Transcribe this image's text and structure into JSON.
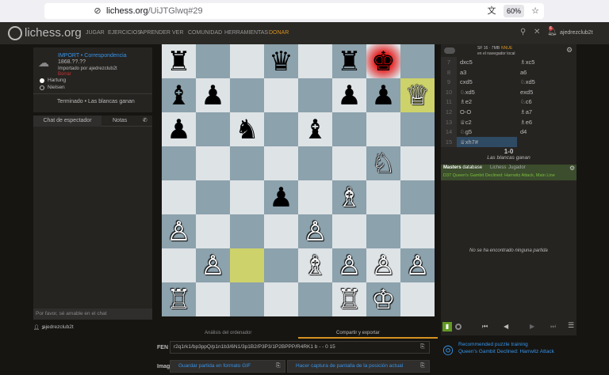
{
  "browser": {
    "url_host": "lichess.org",
    "url_path": "/UiJTGlwq#29",
    "zoom": "60%"
  },
  "nav": {
    "site_name": "lichess.org",
    "items": [
      "JUGAR",
      "EJERCICIOS",
      "APRENDER",
      "VER",
      "COMUNIDAD",
      "HERRAMIENTAS",
      "DONAR"
    ],
    "user": "ajedrezclub2t",
    "notif_count": "6"
  },
  "game_meta": {
    "type": "IMPORT • Correspondencia",
    "date": "1868.??.??",
    "imported_by": "Importado por ajedrezclub2t",
    "delete": "Borrar",
    "white": "Hartung",
    "black": "Nielsen",
    "status": "Terminado • Las blancas ganan"
  },
  "chat": {
    "tab_spectator": "Chat de espectador",
    "tab_notes": "Notas",
    "placeholder": "Por favor, sé amable en el chat"
  },
  "watchers": {
    "count": "1",
    "name": "ajedrezclub2t"
  },
  "board": {
    "ranks": [
      [
        "bR",
        "",
        "",
        "bQ",
        "",
        "bR",
        "bK",
        ""
      ],
      [
        "bB",
        "bP",
        "",
        "",
        "",
        "bP",
        "bP",
        "wQ"
      ],
      [
        "bP",
        "",
        "bN",
        "",
        "bB",
        "",
        "",
        ""
      ],
      [
        "",
        "",
        "",
        "",
        "",
        "",
        "wN",
        ""
      ],
      [
        "",
        "",
        "",
        "bP",
        "",
        "wB",
        "",
        ""
      ],
      [
        "wP",
        "",
        "",
        "",
        "wP",
        "",
        "",
        ""
      ],
      [
        "",
        "wP",
        "",
        "",
        "wB",
        "wP",
        "wP",
        "wP"
      ],
      [
        "wR",
        "",
        "",
        "",
        "",
        "wR",
        "wK",
        ""
      ]
    ],
    "highlight_squares": [
      "c2",
      "h7"
    ],
    "check_square": "g8",
    "glyphs": {
      "wK": "♔",
      "wQ": "♕",
      "wR": "♖",
      "wB": "♗",
      "wN": "♘",
      "wP": "♙",
      "bK": "♚",
      "bQ": "♛",
      "bR": "♜",
      "bB": "♝",
      "bN": "♞",
      "bP": "♟"
    }
  },
  "engine": {
    "label": "SF 16 · 7MB",
    "sublabel": "en el navegador local",
    "nnue": "NNUE"
  },
  "moves": [
    {
      "n": "7",
      "a": "dxc5",
      "b": "♗xc5"
    },
    {
      "n": "8",
      "a": "a3",
      "b": "a6"
    },
    {
      "n": "9",
      "a": "cxd5",
      "b": "♘xd5"
    },
    {
      "n": "10",
      "a": "♘xd5",
      "b": "exd5"
    },
    {
      "n": "11",
      "a": "♗e2",
      "b": "♘c6"
    },
    {
      "n": "12",
      "a": "O-O",
      "b": "♗a7"
    },
    {
      "n": "13",
      "a": "♕c2",
      "b": "♗e6"
    },
    {
      "n": "14",
      "a": "♘g5",
      "b": "d4"
    },
    {
      "n": "15",
      "a": "♕xh7#",
      "b": ""
    }
  ],
  "result": {
    "score": "1-0",
    "text": "Las blancas ganan"
  },
  "explorer": {
    "tab_masters": "Masters",
    "tab_database": "database",
    "tab_lichess": "Lichess",
    "tab_player": "Jugador",
    "opening": "D37 Queen's Gambit Declined: Harrwitz Attack, Main Line",
    "empty": "No se ha encontrado ninguna partida"
  },
  "bottom": {
    "tab_analysis": "Análisis del ordenador",
    "tab_share": "Compartir y exportar",
    "fen_label": "FEN",
    "fen_value": "r2q1rk1/bp3ppQ/p1n1b3/6N1/3p1B2/P3P3/1P2BPPP/R4RK1 b - - 0 15",
    "image_label": "Image",
    "gif_button": "Guardar partida en formato GIF",
    "screenshot_button": "Hacer captura de pantalla de la posición actual"
  },
  "puzzle": {
    "title": "Recommended puzzle training",
    "subtitle": "Queen's Gambit Declined: Harrwitz Attack"
  },
  "colors": {
    "accent": "#3692e7",
    "highlight": "#cdd26a",
    "board_light": "#dee3e6",
    "board_dark": "#8ca2ad",
    "donate": "#d59120"
  }
}
